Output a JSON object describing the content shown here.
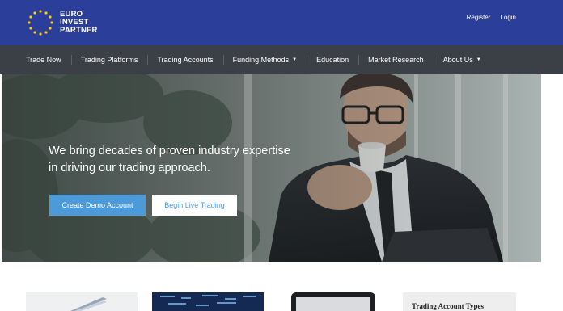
{
  "brand": {
    "logo_lines": [
      "EURO",
      "INVEST",
      "PARTNER"
    ],
    "primary_color": "#2b3f9a",
    "nav_color": "#3b3f46",
    "accent_color": "#4d9ad9"
  },
  "header": {
    "register_label": "Register",
    "login_label": "Login"
  },
  "nav": {
    "items": [
      {
        "label": "Trade Now",
        "dropdown": false
      },
      {
        "label": "Trading Platforms",
        "dropdown": false
      },
      {
        "label": "Trading Accounts",
        "dropdown": false
      },
      {
        "label": "Funding Methods",
        "dropdown": true
      },
      {
        "label": "Education",
        "dropdown": false
      },
      {
        "label": "Market Research",
        "dropdown": false
      },
      {
        "label": "About Us",
        "dropdown": true
      }
    ],
    "caret_icon": "chevron-down-icon"
  },
  "hero": {
    "heading_lines": [
      "We bring decades of proven industry expertise",
      "in driving our trading approach."
    ],
    "demo_button_label": "Create Demo Account",
    "live_button_label": "Begin Live Trading"
  },
  "cards": {
    "account_types_title": "Trading Account Types"
  }
}
